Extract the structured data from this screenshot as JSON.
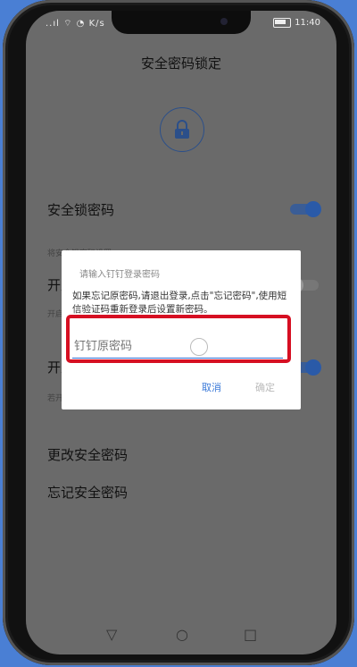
{
  "status": {
    "signal": "..ıl ⌔ ◔ K/s",
    "time": "11:40"
  },
  "header": {
    "title": "安全密码锁定"
  },
  "settings": {
    "lock_label": "安全锁密码",
    "lock_hint": "将安全锁密码设置",
    "row2_label": "开启",
    "row2_hint": "开启后",
    "row3_label": "开启",
    "row3_hint": "若开启",
    "change_label": "更改安全密码",
    "forgot_label": "忘记安全密码"
  },
  "dialog": {
    "title": "请输入钉钉登录密码",
    "message": "如果忘记原密码,请退出登录,点击\"忘记密码\",使用短信验证码重新登录后设置新密码。",
    "input_placeholder": "钉钉原密码",
    "cancel_label": "取消",
    "ok_label": "确定"
  },
  "nav": {
    "back": "▽",
    "home": "○",
    "recent": "□"
  },
  "colors": {
    "accent": "#2b6ad0",
    "highlight": "#d60f22"
  }
}
